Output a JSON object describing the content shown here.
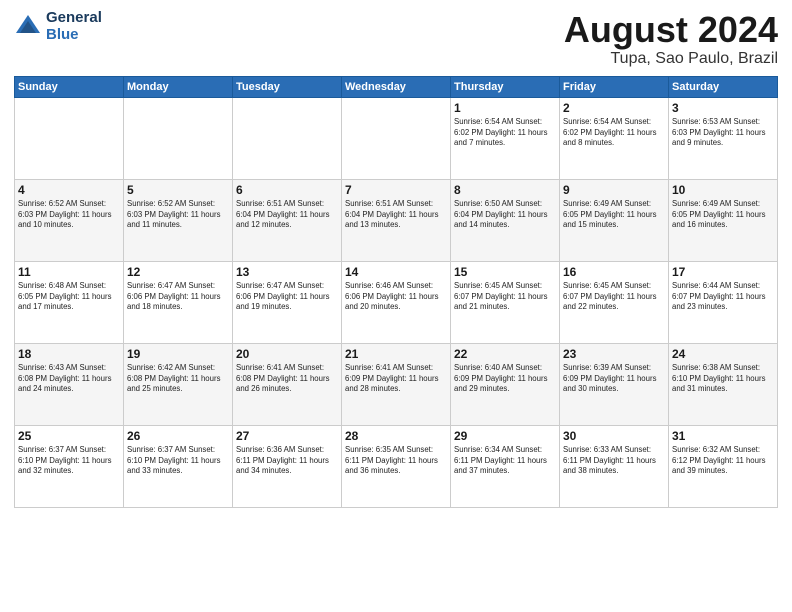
{
  "logo": {
    "line1": "General",
    "line2": "Blue"
  },
  "title": "August 2024",
  "location": "Tupa, Sao Paulo, Brazil",
  "days_of_week": [
    "Sunday",
    "Monday",
    "Tuesday",
    "Wednesday",
    "Thursday",
    "Friday",
    "Saturday"
  ],
  "weeks": [
    [
      {
        "day": "",
        "info": ""
      },
      {
        "day": "",
        "info": ""
      },
      {
        "day": "",
        "info": ""
      },
      {
        "day": "",
        "info": ""
      },
      {
        "day": "1",
        "info": "Sunrise: 6:54 AM\nSunset: 6:02 PM\nDaylight: 11 hours\nand 7 minutes."
      },
      {
        "day": "2",
        "info": "Sunrise: 6:54 AM\nSunset: 6:02 PM\nDaylight: 11 hours\nand 8 minutes."
      },
      {
        "day": "3",
        "info": "Sunrise: 6:53 AM\nSunset: 6:03 PM\nDaylight: 11 hours\nand 9 minutes."
      }
    ],
    [
      {
        "day": "4",
        "info": "Sunrise: 6:52 AM\nSunset: 6:03 PM\nDaylight: 11 hours\nand 10 minutes."
      },
      {
        "day": "5",
        "info": "Sunrise: 6:52 AM\nSunset: 6:03 PM\nDaylight: 11 hours\nand 11 minutes."
      },
      {
        "day": "6",
        "info": "Sunrise: 6:51 AM\nSunset: 6:04 PM\nDaylight: 11 hours\nand 12 minutes."
      },
      {
        "day": "7",
        "info": "Sunrise: 6:51 AM\nSunset: 6:04 PM\nDaylight: 11 hours\nand 13 minutes."
      },
      {
        "day": "8",
        "info": "Sunrise: 6:50 AM\nSunset: 6:04 PM\nDaylight: 11 hours\nand 14 minutes."
      },
      {
        "day": "9",
        "info": "Sunrise: 6:49 AM\nSunset: 6:05 PM\nDaylight: 11 hours\nand 15 minutes."
      },
      {
        "day": "10",
        "info": "Sunrise: 6:49 AM\nSunset: 6:05 PM\nDaylight: 11 hours\nand 16 minutes."
      }
    ],
    [
      {
        "day": "11",
        "info": "Sunrise: 6:48 AM\nSunset: 6:05 PM\nDaylight: 11 hours\nand 17 minutes."
      },
      {
        "day": "12",
        "info": "Sunrise: 6:47 AM\nSunset: 6:06 PM\nDaylight: 11 hours\nand 18 minutes."
      },
      {
        "day": "13",
        "info": "Sunrise: 6:47 AM\nSunset: 6:06 PM\nDaylight: 11 hours\nand 19 minutes."
      },
      {
        "day": "14",
        "info": "Sunrise: 6:46 AM\nSunset: 6:06 PM\nDaylight: 11 hours\nand 20 minutes."
      },
      {
        "day": "15",
        "info": "Sunrise: 6:45 AM\nSunset: 6:07 PM\nDaylight: 11 hours\nand 21 minutes."
      },
      {
        "day": "16",
        "info": "Sunrise: 6:45 AM\nSunset: 6:07 PM\nDaylight: 11 hours\nand 22 minutes."
      },
      {
        "day": "17",
        "info": "Sunrise: 6:44 AM\nSunset: 6:07 PM\nDaylight: 11 hours\nand 23 minutes."
      }
    ],
    [
      {
        "day": "18",
        "info": "Sunrise: 6:43 AM\nSunset: 6:08 PM\nDaylight: 11 hours\nand 24 minutes."
      },
      {
        "day": "19",
        "info": "Sunrise: 6:42 AM\nSunset: 6:08 PM\nDaylight: 11 hours\nand 25 minutes."
      },
      {
        "day": "20",
        "info": "Sunrise: 6:41 AM\nSunset: 6:08 PM\nDaylight: 11 hours\nand 26 minutes."
      },
      {
        "day": "21",
        "info": "Sunrise: 6:41 AM\nSunset: 6:09 PM\nDaylight: 11 hours\nand 28 minutes."
      },
      {
        "day": "22",
        "info": "Sunrise: 6:40 AM\nSunset: 6:09 PM\nDaylight: 11 hours\nand 29 minutes."
      },
      {
        "day": "23",
        "info": "Sunrise: 6:39 AM\nSunset: 6:09 PM\nDaylight: 11 hours\nand 30 minutes."
      },
      {
        "day": "24",
        "info": "Sunrise: 6:38 AM\nSunset: 6:10 PM\nDaylight: 11 hours\nand 31 minutes."
      }
    ],
    [
      {
        "day": "25",
        "info": "Sunrise: 6:37 AM\nSunset: 6:10 PM\nDaylight: 11 hours\nand 32 minutes."
      },
      {
        "day": "26",
        "info": "Sunrise: 6:37 AM\nSunset: 6:10 PM\nDaylight: 11 hours\nand 33 minutes."
      },
      {
        "day": "27",
        "info": "Sunrise: 6:36 AM\nSunset: 6:11 PM\nDaylight: 11 hours\nand 34 minutes."
      },
      {
        "day": "28",
        "info": "Sunrise: 6:35 AM\nSunset: 6:11 PM\nDaylight: 11 hours\nand 36 minutes."
      },
      {
        "day": "29",
        "info": "Sunrise: 6:34 AM\nSunset: 6:11 PM\nDaylight: 11 hours\nand 37 minutes."
      },
      {
        "day": "30",
        "info": "Sunrise: 6:33 AM\nSunset: 6:11 PM\nDaylight: 11 hours\nand 38 minutes."
      },
      {
        "day": "31",
        "info": "Sunrise: 6:32 AM\nSunset: 6:12 PM\nDaylight: 11 hours\nand 39 minutes."
      }
    ]
  ]
}
